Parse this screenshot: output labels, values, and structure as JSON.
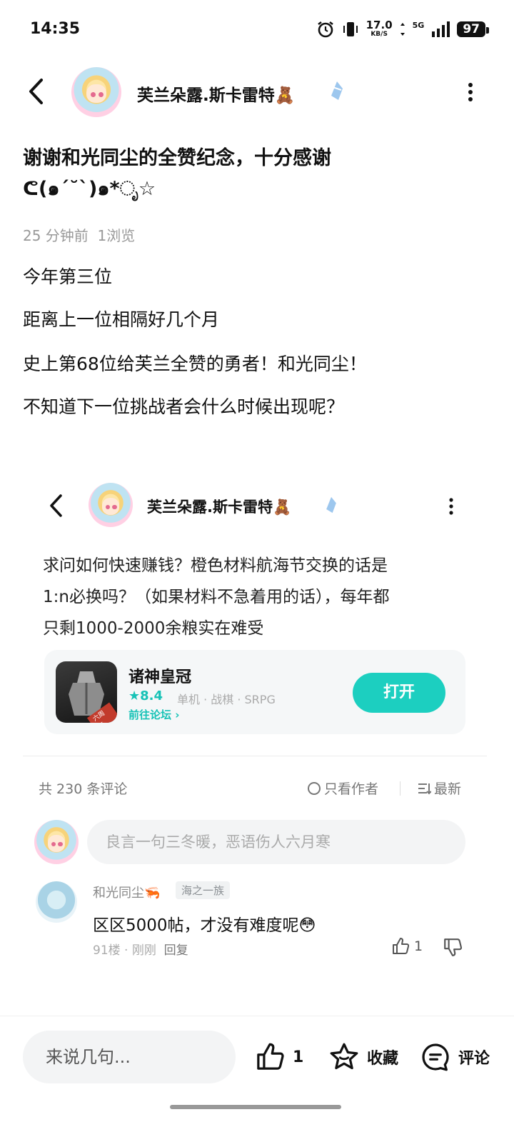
{
  "status_bar": {
    "time": "14:35",
    "net_speed": "17.0",
    "net_unit": "KB/S",
    "network": "5G",
    "battery": "97"
  },
  "header": {
    "author_name": "芙兰朵露.斯卡雷特🧸"
  },
  "post": {
    "title_line1": "谢谢和光同尘的全赞纪念，十分感谢",
    "title_line2": "ᕦ(๑´˘`)๑*ೃ☆",
    "time_ago": "25 分钟前",
    "views": "1浏览",
    "paragraphs": [
      "今年第三位",
      "距离上一位相隔好几个月",
      "史上第68位给芙兰全赞的勇者！和光同尘！",
      "不知道下一位挑战者会什么时候出现呢？"
    ]
  },
  "embed": {
    "author_name": "芙兰朵露.斯卡雷特🧸",
    "text_lines": [
      "求问如何快速赚钱？橙色材料航海节交换的话是",
      "1:n必换吗？（如果材料不急着用的话），每年都",
      "只剩1000-2000余粮实在难受"
    ],
    "game": {
      "title": "诸神皇冠",
      "rating": "8.4",
      "tags": "单机 · 战棋 · SRPG",
      "forum_link": "前往论坛",
      "open_label": "打开",
      "icon_badge": "六周年"
    }
  },
  "comments": {
    "count_label": "共 230 条评论",
    "author_only_label": "只看作者",
    "sort_label": "最新",
    "input_placeholder": "良言一句三冬暖，恶语伤人六月寒",
    "items": [
      {
        "user": "和光同尘🦐",
        "badge": "海之一族",
        "text": "区区5000帖，才没有难度呢😳",
        "floor": "91楼",
        "time": "刚刚",
        "reply_label": "回复",
        "likes": "1"
      }
    ]
  },
  "bottom_bar": {
    "input_placeholder": "来说几句...",
    "like_count": "1",
    "favorite_label": "收藏",
    "comment_label": "评论"
  }
}
